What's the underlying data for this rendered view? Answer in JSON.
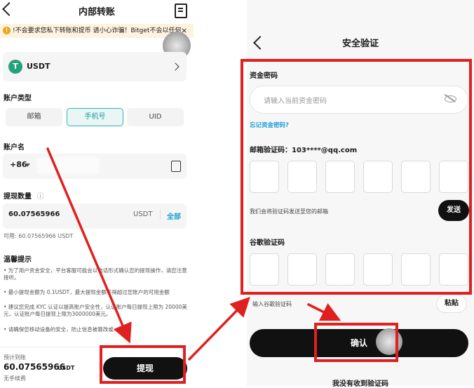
{
  "left": {
    "title": "内部转账",
    "notice": "!不会要求您私下转账和提币 请小心诈骗！Bitget不会以任何形式",
    "notice_close": "×",
    "warn_glyph": "!",
    "coin": {
      "name": "USDT",
      "glyph": "T",
      "color": "#26a17b"
    },
    "account_type_label": "账户类型",
    "account_types": [
      "邮箱",
      "手机号",
      "UID"
    ],
    "account_name_label": "账户名",
    "phone_code": "+86",
    "amount_label": "提现数量",
    "info_glyph": "ⓘ",
    "amount_value": "60.07565966",
    "amount_unit": "USDT",
    "all_label": "全部",
    "available": "可用: 60.07565966 USDT",
    "tips_title": "温馨提示",
    "tips": [
      "• 为了用户资金安全，平台客服可能会以电话形式确认您的提现操作，请您注意接听。",
      "• 最小提现金额为 0.1USDT，最大提现金额不得超过您账户的可用金额",
      "• 建议您完成 KYC 认证以提高账户安全性，认证账户每日提现上限为 20000美元，认证账户每日提现上限为3000000美元。",
      "• 请确保您移动设备的安全，防止信息被篡改或..."
    ],
    "estimate_label": "预计到账",
    "estimate_amount": "60.07565966",
    "estimate_unit": "USDT",
    "fee_label": "无手续费",
    "withdraw_button": "提现"
  },
  "right": {
    "title": "安全验证",
    "fund_password_label": "资金密码",
    "fund_password_placeholder": "请输入当前资金密码",
    "forgot_link": "忘记资金密码?",
    "email_code_label": "邮箱验证码：103****@qq.com",
    "email_sent_note": "我们会将验证码发送至您的邮箱",
    "send_button": "发送",
    "google_code_label": "谷歌验证码",
    "google_input_hint": "输入谷歌验证码",
    "paste_button": "粘贴",
    "confirm_button": "确认",
    "no_code_link": "我没有收到验证码"
  },
  "colors": {
    "accent_teal": "#2bb5b0",
    "link_blue": "#1b9fd6",
    "highlight_red": "#e02020"
  }
}
